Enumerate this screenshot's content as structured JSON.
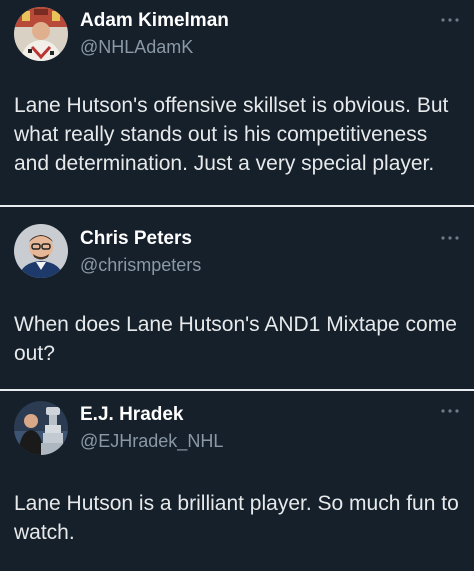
{
  "tweets": [
    {
      "name": "Adam Kimelman",
      "handle": "@NHLAdamK",
      "text": "Lane Hutson's offensive skillset is obvious. But what really stands out is his competitiveness and determination. Just a very special player.",
      "more_icon": "more-horizontal-icon"
    },
    {
      "name": "Chris Peters",
      "handle": "@chrismpeters",
      "text": "When does Lane Hutson's AND1 Mixtape come out?",
      "more_icon": "more-horizontal-icon"
    },
    {
      "name": "E.J. Hradek",
      "handle": "@EJHradek_NHL",
      "text": "Lane Hutson is a brilliant player. So much fun to watch.",
      "more_icon": "more-horizontal-icon"
    }
  ],
  "colors": {
    "background": "#15202b",
    "text": "#e7e9ea",
    "secondary": "#8b98a5",
    "divider": "#e9ecef"
  }
}
